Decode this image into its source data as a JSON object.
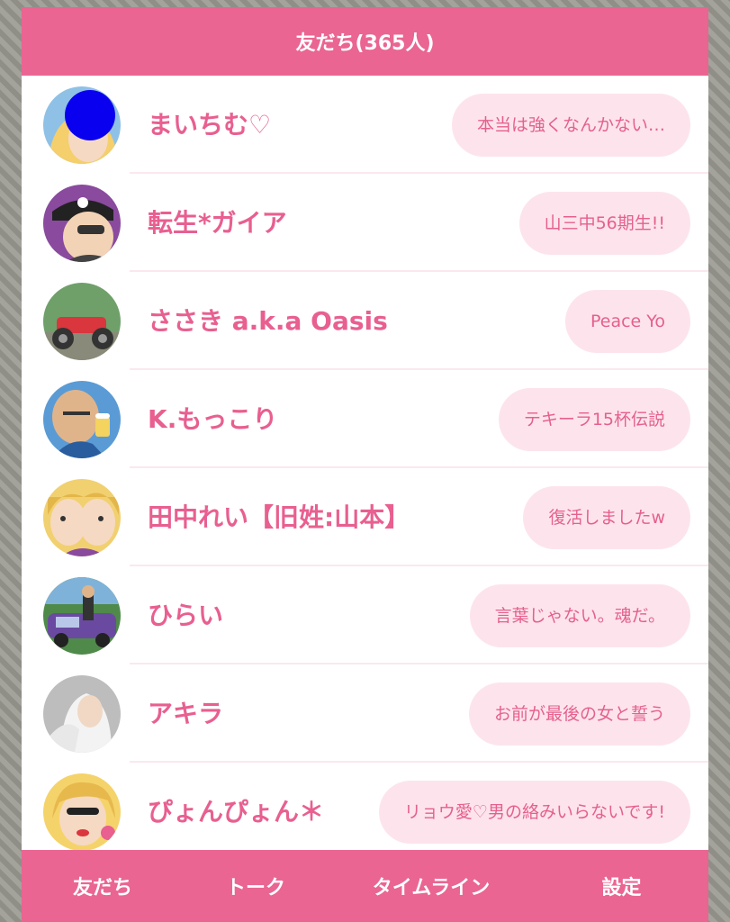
{
  "header": {
    "title": "友だち(365人)"
  },
  "friends": [
    {
      "name": "まいちむ♡",
      "status": "本当は強くなんかない…",
      "avatar_icon": "friend-avatar-icon"
    },
    {
      "name": "転生*ガイア",
      "status": "山三中56期生!!",
      "avatar_icon": "friend-avatar-icon"
    },
    {
      "name": "ささき a.k.a Oasis",
      "status": "Peace Yo",
      "avatar_icon": "friend-avatar-icon"
    },
    {
      "name": "K.もっこり",
      "status": "テキーラ15杯伝説",
      "avatar_icon": "friend-avatar-icon"
    },
    {
      "name": "田中れい【旧姓:山本】",
      "status": "復活しましたw",
      "avatar_icon": "friend-avatar-icon"
    },
    {
      "name": "ひらい",
      "status": "言葉じゃない。魂だ。",
      "avatar_icon": "friend-avatar-icon"
    },
    {
      "name": "アキラ",
      "status": "お前が最後の女と誓う",
      "avatar_icon": "friend-avatar-icon"
    },
    {
      "name": "ぴょんぴょん＊",
      "status": "リョウ愛♡男の絡みいらないです!",
      "avatar_icon": "friend-avatar-icon"
    }
  ],
  "tabs": [
    {
      "label": "友だち"
    },
    {
      "label": "トーク"
    },
    {
      "label": "タイムライン"
    },
    {
      "label": "設定"
    }
  ],
  "colors": {
    "accent": "#ea6592",
    "bubble": "#fde4ec",
    "text": "#e85f90"
  }
}
